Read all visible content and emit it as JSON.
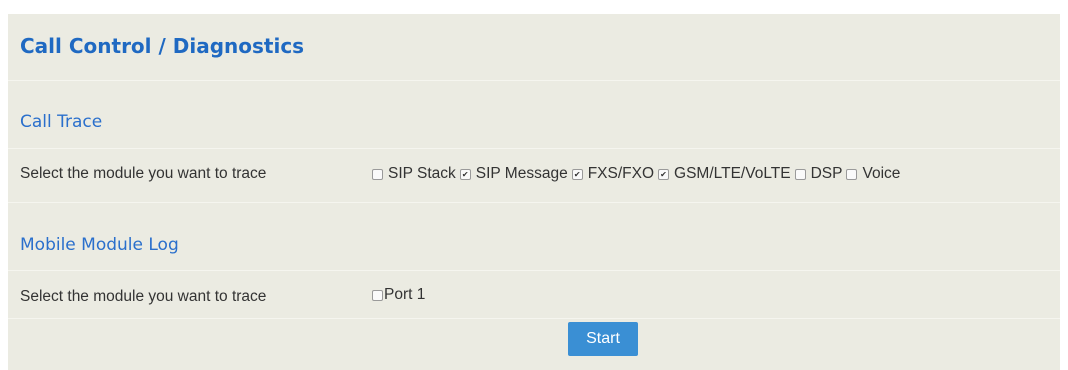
{
  "page": {
    "title": "Call Control / Diagnostics"
  },
  "call_trace": {
    "section_title": "Call Trace",
    "row_label": "Select the module you want to trace",
    "modules": [
      {
        "label": "SIP Stack",
        "checked": false
      },
      {
        "label": "SIP Message",
        "checked": true
      },
      {
        "label": "FXS/FXO",
        "checked": true
      },
      {
        "label": "GSM/LTE/VoLTE",
        "checked": true
      },
      {
        "label": "DSP",
        "checked": false
      },
      {
        "label": "Voice",
        "checked": false
      }
    ]
  },
  "mobile_module_log": {
    "section_title": "Mobile Module Log",
    "row_label": "Select the module you want to trace",
    "ports": [
      {
        "label": "Port 1",
        "checked": false
      }
    ]
  },
  "actions": {
    "start_label": "Start"
  },
  "colors": {
    "panel_background": "#ebebe2",
    "title_blue": "#1f69c2",
    "button_blue": "#3a8fd4"
  }
}
